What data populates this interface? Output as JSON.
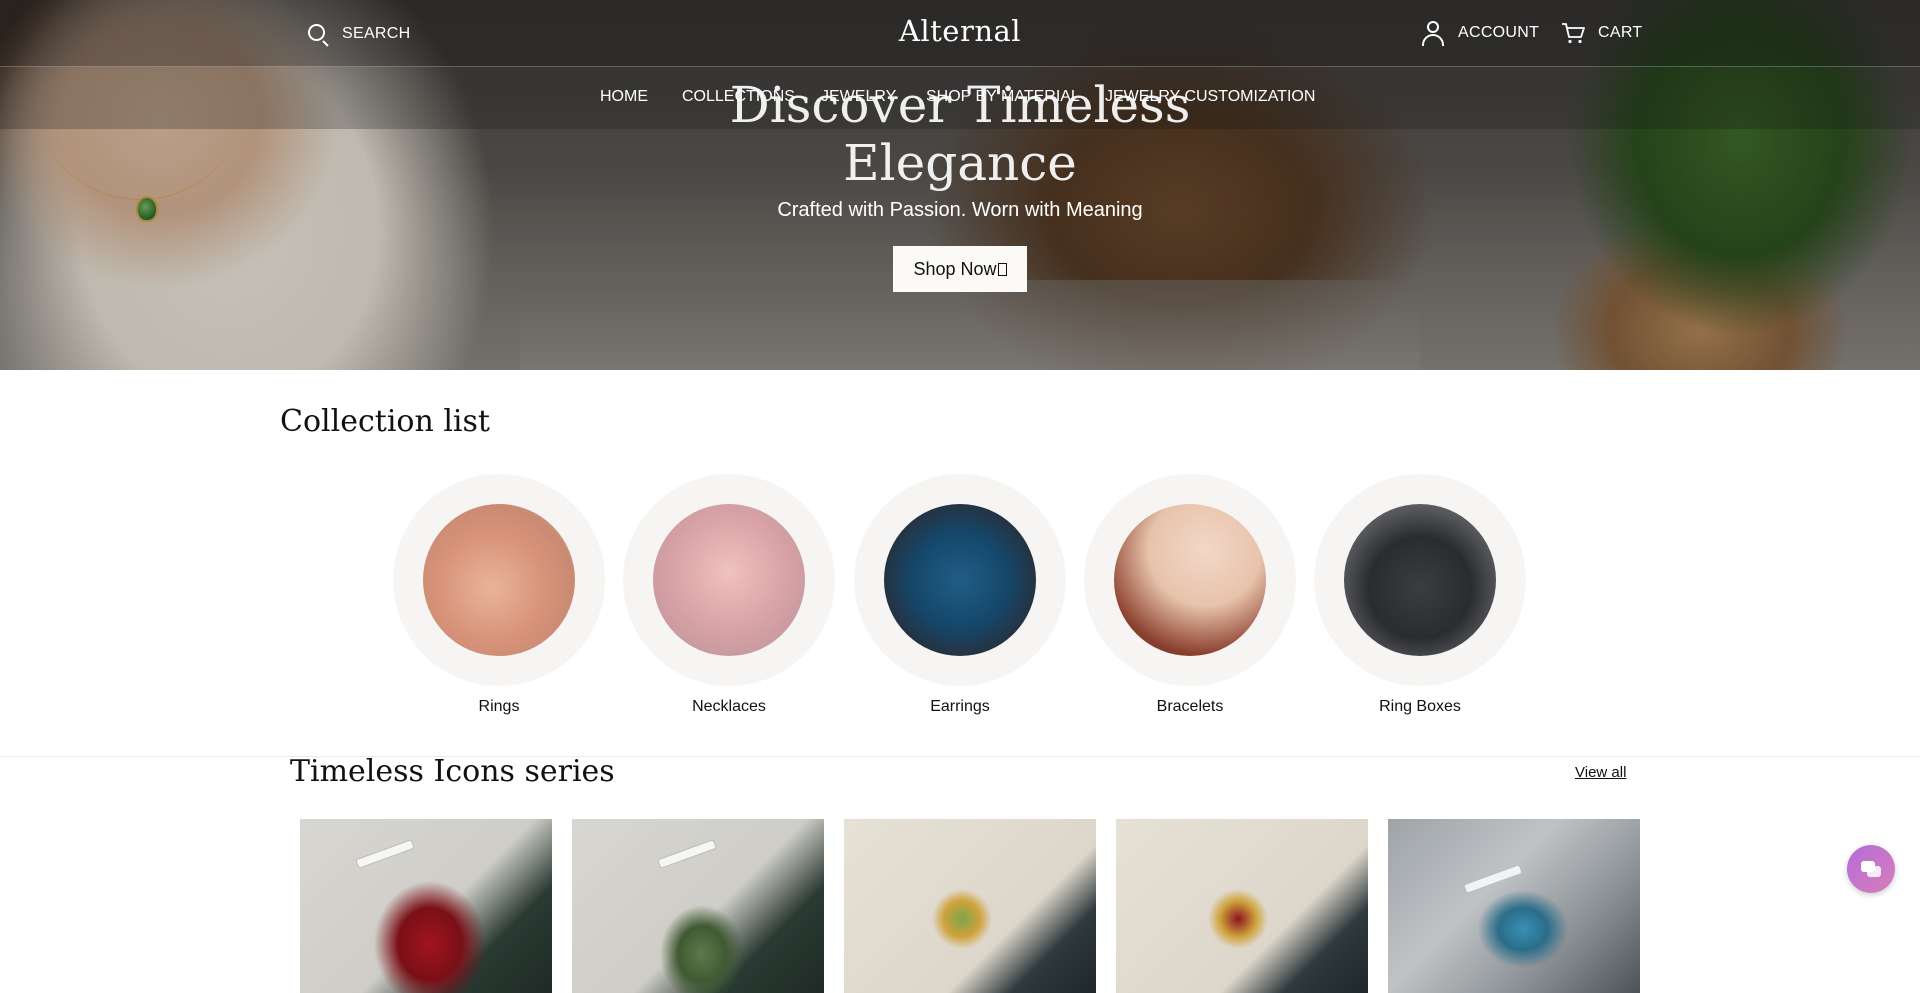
{
  "header": {
    "search_label": "SEARCH",
    "logo": "Alternal",
    "account_label": "ACCOUNT",
    "cart_label": "CART"
  },
  "nav": {
    "home": "HOME",
    "collections": "COLLECTIONS",
    "jewelry": "JEWELRY",
    "shop_by_material": "SHOP BY MATERIAL",
    "customization": "JEWELRY CUSTOMIZATION"
  },
  "hero": {
    "title_line1": "Discover Timeless",
    "title_line2": "Elegance",
    "subtitle": "Crafted with Passion. Worn with Meaning",
    "button_label": "Shop Now"
  },
  "collection_list": {
    "title": "Collection list",
    "items": [
      {
        "label": "Rings"
      },
      {
        "label": "Necklaces"
      },
      {
        "label": "Earrings"
      },
      {
        "label": "Bracelets"
      },
      {
        "label": "Ring Boxes"
      }
    ]
  },
  "series": {
    "title": "Timeless Icons series",
    "view_all": "View all"
  },
  "colors": {
    "chat_gradient_start": "#b56bd8",
    "chat_gradient_end": "#d77fb9",
    "hero_button_bg": "#fbfaf7"
  },
  "icons": [
    "search-icon",
    "person-icon",
    "cart-icon",
    "chat-icon"
  ]
}
